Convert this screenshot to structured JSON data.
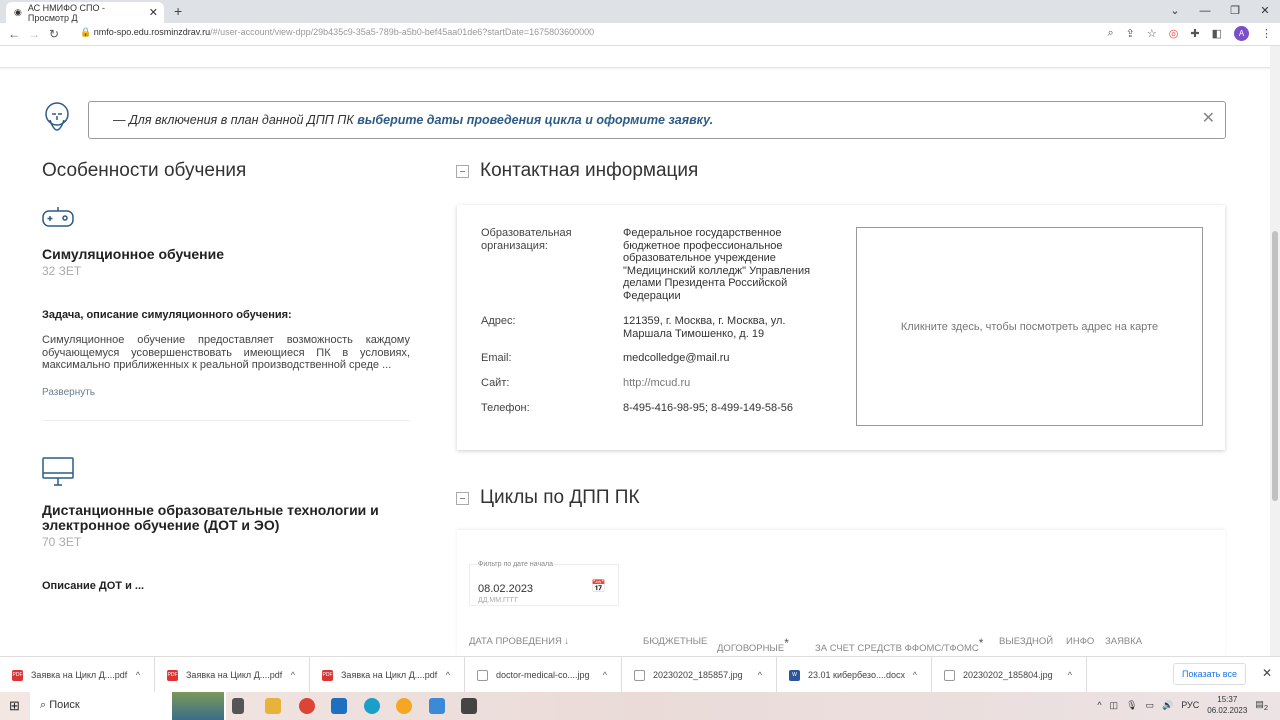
{
  "browser": {
    "tab_title": "АС НМИФО СПО - Просмотр Д",
    "url_host": "nmfo-spo.edu.rosminzdrav.ru",
    "url_path": "/#/user-account/view-dpp/29b435c9-35a5-789b-a5b0-bef45aa01de6?startDate=1675803600000",
    "avatar": "A"
  },
  "notice": {
    "text": "— Для включения в план данной ДПП ПК ",
    "link": "выберите даты проведения цикла и оформите заявку."
  },
  "features": {
    "title": "Особенности обучения",
    "items": [
      {
        "title": "Симуляционное обучение",
        "zet": "32 ЗЕТ",
        "task_title": "Задача, описание симуляционного обучения:",
        "description": "Симуляционное обучение предоставляет возможность каждому обучающемуся усовершенствовать имеющиеся ПК в условиях, максимально приближенных к реальной производственной среде ...",
        "expand": "Развернуть"
      },
      {
        "title": "Дистанционные образовательные технологии и электронное обучение (ДОТ и ЭО)",
        "zet": "70 ЗЕТ",
        "description": "Описание ДОТ и ..."
      }
    ]
  },
  "contacts": {
    "title": "Контактная информация",
    "rows": [
      {
        "label": "Образовательная организация:",
        "value": "Федеральное государственное бюджетное профессиональное образовательное учреждение \"Медицинский колледж\" Управления делами Президента Российской Федерации"
      },
      {
        "label": "Адрес:",
        "value": "121359, г. Москва, г. Москва, ул. Маршала Тимошенко, д. 19"
      },
      {
        "label": "Email:",
        "value": "medcolledge@mail.ru"
      },
      {
        "label": "Сайт:",
        "value": "http://mcud.ru"
      },
      {
        "label": "Телефон:",
        "value": "8-495-416-98-95; 8-499-149-58-56"
      }
    ],
    "map_hint": "Кликните здесь, чтобы посмотреть адрес на карте"
  },
  "cycles": {
    "title": "Циклы по ДПП ПК",
    "filter_label": "Фильтр по дате начала",
    "filter_value": "08.02.2023",
    "filter_hint": "ДД.ММ.ГГГГ",
    "columns": [
      "ДАТА ПРОВЕДЕНИЯ ↓",
      "БЮДЖЕТНЫЕ",
      "ДОГОВОРНЫЕ",
      "ЗА СЧЕТ СРЕДСТВ ФФОМС/ТФОМС",
      "ВЫЕЗДНОЙ",
      "ИНФО",
      "ЗАЯВКА"
    ],
    "asterisk": "*"
  },
  "downloads": {
    "items": [
      "Заявка на Цикл Д....pdf",
      "Заявка на Цикл Д....pdf",
      "Заявка на Цикл Д....pdf",
      "doctor-medical-co....jpg",
      "20230202_185857.jpg",
      "23.01 кибербезо....docx",
      "20230202_185804.jpg"
    ],
    "show_all": "Показать все"
  },
  "taskbar": {
    "search": "Поиск",
    "lang": "РУС",
    "time": "15:37",
    "date": "06.02.2023",
    "notif": "2"
  }
}
